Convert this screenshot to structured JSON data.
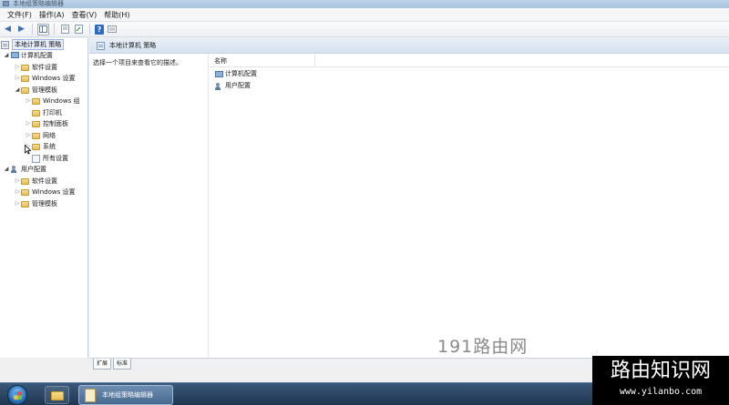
{
  "window": {
    "title": "本地组策略编辑器"
  },
  "menubar": {
    "items": [
      "文件(F)",
      "操作(A)",
      "查看(V)",
      "帮助(H)"
    ]
  },
  "toolbar": {
    "back": "◀",
    "forward": "▶",
    "help": "?"
  },
  "tree": {
    "root": "本地计算机 策略",
    "computer_config": "计算机配置",
    "software_settings": "软件设置",
    "windows_settings": "Windows 设置",
    "admin_templates": "管理模板",
    "windows_components": "Windows 组",
    "printers": "打印机",
    "control_panel": "控制面板",
    "network": "网络",
    "system": "系统",
    "all_settings": "所有设置",
    "user_config": "用户配置",
    "user_software_settings": "软件设置",
    "user_windows_settings": "Windows 设置",
    "user_admin_templates": "管理模板"
  },
  "right_pane": {
    "header": "本地计算机 策略",
    "description": "选择一个项目来查看它的描述。",
    "column_name": "名称",
    "items": [
      "计算机配置",
      "用户配置"
    ]
  },
  "bottom_tabs": [
    "扩展",
    "标准"
  ],
  "watermark": {
    "mid": "191路由网",
    "box_title": "路由知识网",
    "box_url": "www.yilanbo.com"
  },
  "taskbar": {
    "app_label": "本地组策略编辑器"
  },
  "colors": {
    "selection": "#e5eefa",
    "folder": "#e7bd55",
    "taskbar": "#1f3550"
  }
}
